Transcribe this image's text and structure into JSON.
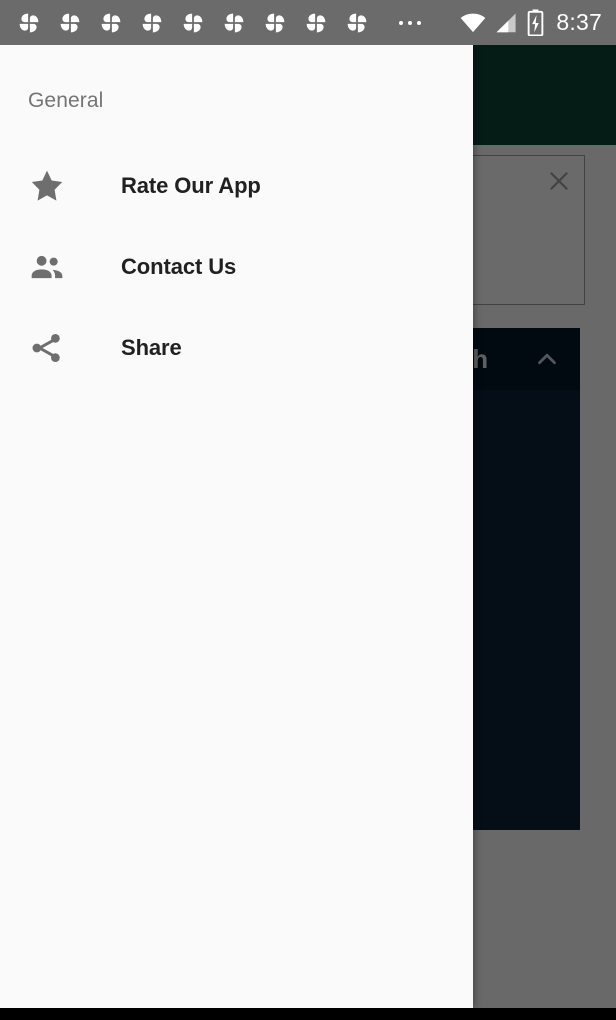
{
  "status_bar": {
    "notification_icons": [
      {
        "name": "pinwheel-icon"
      },
      {
        "name": "pinwheel-icon"
      },
      {
        "name": "pinwheel-icon"
      },
      {
        "name": "pinwheel-icon"
      },
      {
        "name": "pinwheel-icon"
      },
      {
        "name": "pinwheel-icon"
      },
      {
        "name": "pinwheel-icon"
      },
      {
        "name": "pinwheel-icon"
      },
      {
        "name": "pinwheel-icon"
      }
    ],
    "overflow_indicator": "...",
    "wifi_icon": "wifi-icon",
    "signal_icon": "cell-signal-icon",
    "battery_icon": "battery-charging-icon",
    "clock": "8:37",
    "background_color": "#6b6b6b",
    "foreground_color": "#ffffff"
  },
  "drawer": {
    "section_title": "General",
    "background_color": "#fafafa",
    "items": [
      {
        "label": "Rate Our App",
        "icon": "star-icon"
      },
      {
        "label": "Contact Us",
        "icon": "people-icon"
      },
      {
        "label": "Share",
        "icon": "share-icon"
      }
    ]
  },
  "app": {
    "header_color": "#0d4435",
    "card": {
      "close_icon": "close-icon",
      "border_color": "#9aa0a0"
    },
    "panel": {
      "title_visible_text": "ch",
      "collapse_icon": "chevron-up-icon",
      "header_color": "#07182a",
      "body_color": "#0d2338"
    }
  },
  "system": {
    "scrim_color": "rgba(0,0,0,0.58)",
    "nav_bar_color": "#000000"
  }
}
